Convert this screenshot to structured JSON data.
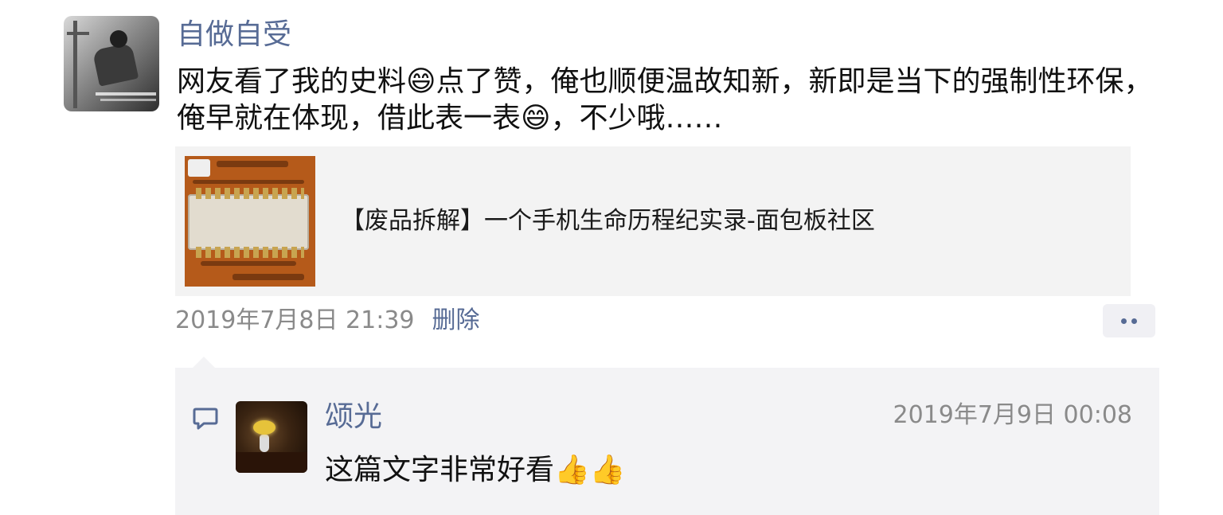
{
  "post": {
    "author": "自做自受",
    "text": "网友看了我的史料😄点了赞，俺也顺便温故知新，新即是当下的强制性环保，俺早就在体现，借此表一表😄，不少哦……",
    "link": {
      "title": "【废品拆解】一个手机生命历程纪实录-面包板社区"
    },
    "timestamp": "2019年7月8日 21:39",
    "delete_label": "删除"
  },
  "comments": [
    {
      "author": "颂光",
      "time": "2019年7月9日 00:08",
      "text": "这篇文字非常好看👍👍"
    }
  ],
  "colors": {
    "link_blue": "#576b95",
    "meta_gray": "#8a8a8a",
    "card_bg": "#f3f3f3"
  }
}
